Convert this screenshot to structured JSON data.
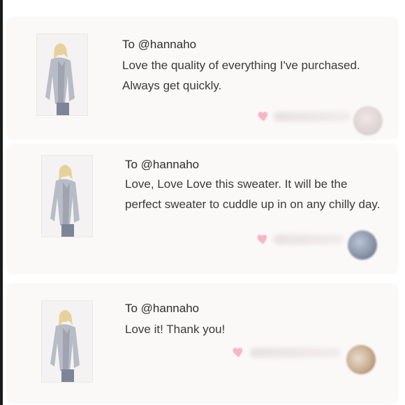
{
  "reviews": [
    {
      "to": "To @hannaho",
      "text": "Love the quality of everything I've purchased. Always get quickly."
    },
    {
      "to": "To @hannaho",
      "text": "Love, Love Love this sweater. It will be the perfect sweater to cuddle up in on any chilly day."
    },
    {
      "to": "To @hannaho",
      "text": "Love it! Thank you!"
    }
  ],
  "colors": {
    "heart": "#f6b6c5",
    "card_background": "#fbf8f8",
    "text": "#3a3a3a"
  },
  "icons": {
    "like": "heart-icon",
    "product": "product-thumbnail",
    "user": "avatar"
  }
}
